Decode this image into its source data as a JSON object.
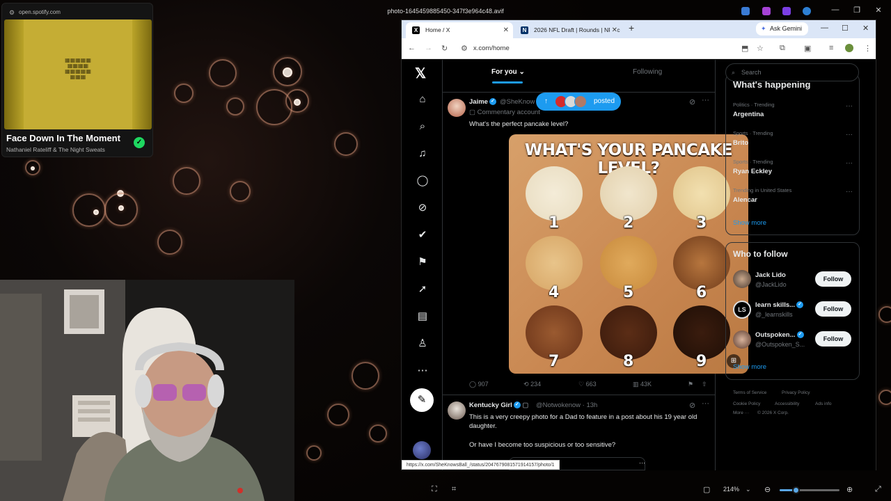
{
  "viewer": {
    "filename": "photo-1645459885450-347f3e964c48.avif",
    "zoom": "214%",
    "zoom_fraction": 0.27
  },
  "spotify": {
    "url": "open.spotify.com",
    "track": "Face Down In The Moment",
    "artist": "Nathaniel Rateliff & The Night Sweats",
    "album_art_text": "SOUTH OF AMERICA · the future"
  },
  "browser": {
    "tabs": [
      {
        "label": "Home / X",
        "active": true
      },
      {
        "label": "2026 NFL Draft | Rounds | NFL.c",
        "active": false
      }
    ],
    "ask_gemini": "Ask Gemini",
    "url": "x.com/home"
  },
  "x": {
    "feed_tabs": {
      "for_you": "For you",
      "following": "Following"
    },
    "posted_pill": "posted",
    "post1": {
      "name": "Jaime",
      "handle": "@SheKnow",
      "context": "Commentary account",
      "text": "What's the perfect pancake level?",
      "image_title": "WHAT'S YOUR PANCAKE LEVEL?",
      "pancakes": [
        "1",
        "2",
        "3",
        "4",
        "5",
        "6",
        "7",
        "8",
        "9"
      ],
      "replies": "907",
      "reposts": "234",
      "likes": "663",
      "views": "43K"
    },
    "post2": {
      "name": "Kentucky Girl",
      "handle": "@Notwokenow · 13h",
      "text": "This is a very creepy photo for a Dad to feature in a post about his 19 year old daughter.",
      "text2": "Or have I become too suspicious or too sensitive?"
    },
    "status_url": "https://x.com/SheKnowsBall_/status/2047679081571914157/photo/1",
    "sidebar": {
      "search_placeholder": "Search",
      "happening_title": "What's happening",
      "trends": [
        {
          "category": "Politics · Trending",
          "name": "Argentina"
        },
        {
          "category": "Sports · Trending",
          "name": "Brito"
        },
        {
          "category": "Sports · Trending",
          "name": "Ryan Eckley"
        },
        {
          "category": "Trending in United States",
          "name": "Alencar"
        }
      ],
      "show_more": "Show more",
      "who_to_follow": "Who to follow",
      "follow_suggestions": [
        {
          "name": "Jack Lido",
          "handle": "@JackLido",
          "button": "Follow"
        },
        {
          "name": "learn skills...",
          "handle": "@_learnskills",
          "button": "Follow"
        },
        {
          "name": "Outspoken...",
          "handle": "@Outspoken_S...",
          "button": "Follow"
        }
      ],
      "footer": [
        "Terms of Service",
        "Privacy Policy",
        "Cookie Policy",
        "Accessibility",
        "Ads info",
        "More ···",
        "© 2026 X Corp."
      ]
    }
  }
}
